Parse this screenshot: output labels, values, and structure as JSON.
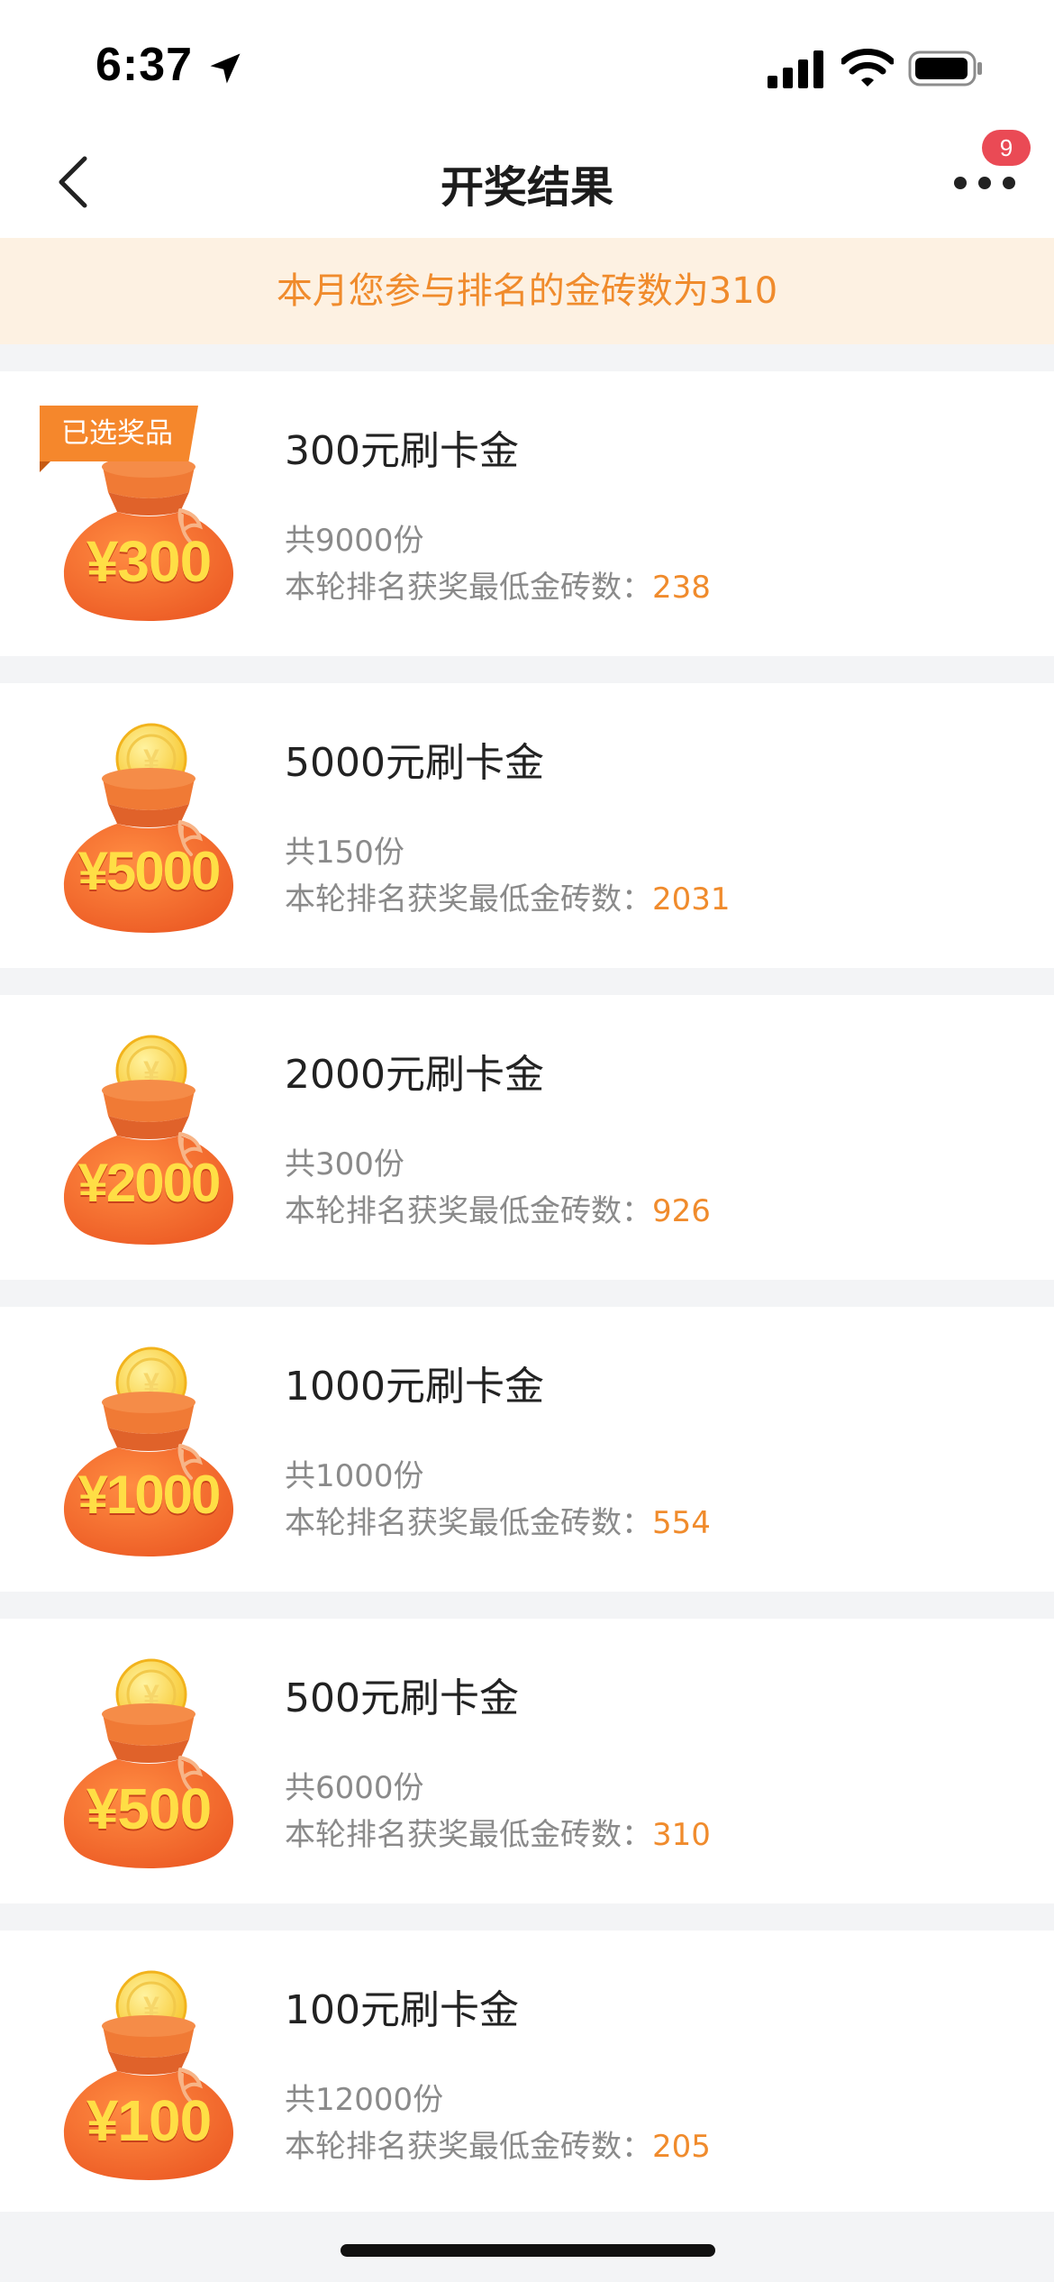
{
  "status_bar": {
    "time": "6:37"
  },
  "nav": {
    "title": "开奖结果",
    "badge_count": "9"
  },
  "notice": {
    "text": "本月您参与排名的金砖数为310"
  },
  "prize_min_label": "本轮排名获奖最低金砖数：",
  "selected_tag_label": "已选奖品",
  "colors": {
    "accent": "#f08b2c",
    "tag": "#f5872c",
    "badge": "#ea4a55",
    "notice_bg": "#fdf1e2"
  },
  "prizes": [
    {
      "name": "300元刷卡金",
      "amount": "¥300",
      "count": "共9000份",
      "min_bricks": "238",
      "selected": true
    },
    {
      "name": "5000元刷卡金",
      "amount": "¥5000",
      "count": "共150份",
      "min_bricks": "2031",
      "selected": false
    },
    {
      "name": "2000元刷卡金",
      "amount": "¥2000",
      "count": "共300份",
      "min_bricks": "926",
      "selected": false
    },
    {
      "name": "1000元刷卡金",
      "amount": "¥1000",
      "count": "共1000份",
      "min_bricks": "554",
      "selected": false
    },
    {
      "name": "500元刷卡金",
      "amount": "¥500",
      "count": "共6000份",
      "min_bricks": "310",
      "selected": false
    },
    {
      "name": "100元刷卡金",
      "amount": "¥100",
      "count": "共12000份",
      "min_bricks": "205",
      "selected": false
    }
  ]
}
